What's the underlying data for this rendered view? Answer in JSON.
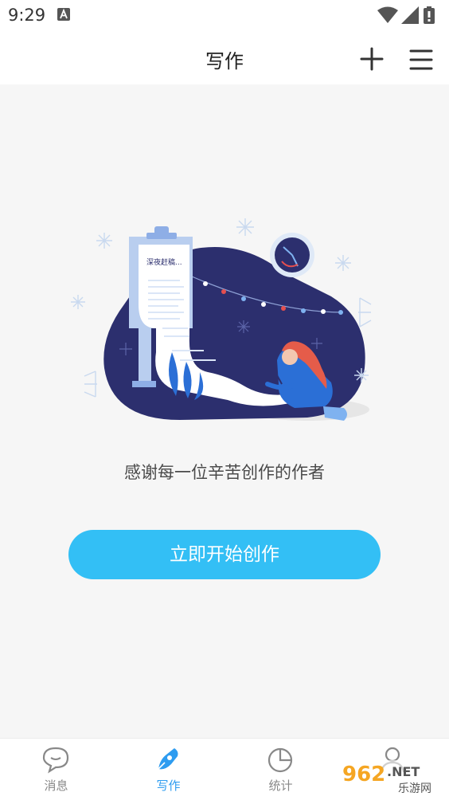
{
  "status_bar": {
    "time": "9:29",
    "icons": [
      "a-notification-icon",
      "wifi-icon",
      "signal-icon",
      "battery-icon"
    ]
  },
  "header": {
    "title": "写作",
    "actions": [
      "add-icon",
      "menu-icon"
    ]
  },
  "illustration": {
    "paper_text": "深夜赶稿..."
  },
  "main": {
    "thanks_text": "感谢每一位辛苦创作的作者",
    "start_button_label": "立即开始创作"
  },
  "bottom_nav": {
    "active_index": 1,
    "items": [
      {
        "label": "消息",
        "icon": "message-icon"
      },
      {
        "label": "写作",
        "icon": "pen-icon"
      },
      {
        "label": "统计",
        "icon": "pie-chart-icon"
      },
      {
        "label": "",
        "icon": "profile-icon"
      }
    ]
  },
  "watermark": {
    "main": "962.NET",
    "sub": "乐游网"
  },
  "colors": {
    "accent": "#33bff5",
    "active_nav": "#2e9cf0",
    "illustration_navy": "#2c2f6e"
  }
}
